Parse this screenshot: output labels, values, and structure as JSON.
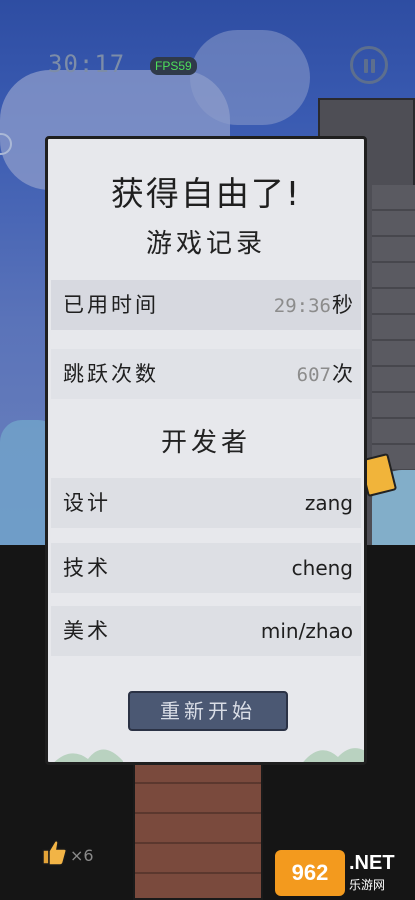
{
  "hud": {
    "timer": "30:17",
    "fps": "FPS59",
    "lives": "×6"
  },
  "dialog": {
    "title": "获得自由了!",
    "record_heading": "游戏记录",
    "developer_heading": "开发者",
    "stats": [
      {
        "label": "已用时间",
        "value": "29:36",
        "unit": "秒"
      },
      {
        "label": "跳跃次数",
        "value": "607",
        "unit": "次"
      }
    ],
    "credits": [
      {
        "role": "设计",
        "name": "zang"
      },
      {
        "role": "技术",
        "name": "cheng"
      },
      {
        "role": "美术",
        "name": "min/zhao"
      }
    ],
    "restart_label": "重新开始"
  },
  "watermark": {
    "logo": "962",
    "net": ".NET",
    "sub": "乐游网"
  },
  "colors": {
    "dialog_bg": "#e7e8ec",
    "button_bg": "#4b5873",
    "fps_green": "#4de05b"
  }
}
